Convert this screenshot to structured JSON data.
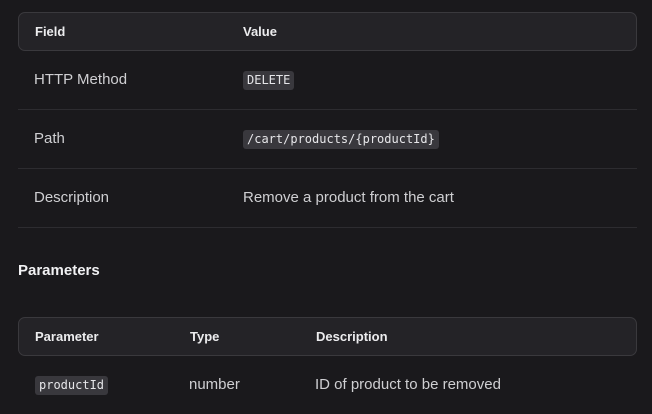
{
  "info_table": {
    "headers": {
      "field": "Field",
      "value": "Value"
    },
    "rows": [
      {
        "field": "HTTP Method",
        "value": "DELETE",
        "code": true
      },
      {
        "field": "Path",
        "value": "/cart/products/{productId}",
        "code": true
      },
      {
        "field": "Description",
        "value": "Remove a product from the cart",
        "code": false
      }
    ]
  },
  "parameters_section": {
    "title": "Parameters"
  },
  "params_table": {
    "headers": {
      "parameter": "Parameter",
      "type": "Type",
      "description": "Description"
    },
    "rows": [
      {
        "parameter": "productId",
        "type": "number",
        "description": "ID of product to be removed"
      }
    ]
  }
}
